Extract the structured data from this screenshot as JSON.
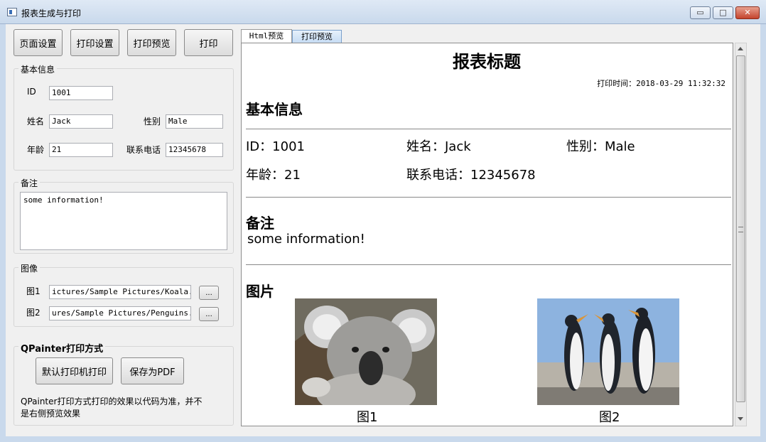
{
  "window": {
    "title": "报表生成与打印",
    "min_label": "▭",
    "max_label": "□",
    "close_label": "✕"
  },
  "toolbar": {
    "page_setup": "页面设置",
    "print_setup": "打印设置",
    "print_preview": "打印预览",
    "print": "打印"
  },
  "basic_info": {
    "title": "基本信息",
    "id_label": "ID",
    "id_value": "1001",
    "name_label": "姓名",
    "name_value": "Jack",
    "gender_label": "性别",
    "gender_value": "Male",
    "age_label": "年龄",
    "age_value": "21",
    "phone_label": "联系电话",
    "phone_value": "12345678"
  },
  "notes": {
    "title": "备注",
    "value": "some information!"
  },
  "images": {
    "title": "图像",
    "img1_label": "图1",
    "img1_path": "ictures/Sample Pictures/Koala.jpg",
    "img2_label": "图2",
    "img2_path": "ures/Sample Pictures/Penguins.jpg",
    "browse_label": "..."
  },
  "qpainter": {
    "title": "QPainter打印方式",
    "default_printer": "默认打印机打印",
    "save_pdf": "保存为PDF",
    "note_line1": "QPainter打印方式打印的效果以代码为准，并不",
    "note_line2": "是右侧预览效果"
  },
  "tabs": [
    {
      "label": "Html预览"
    },
    {
      "label": "打印预览"
    }
  ],
  "report": {
    "title": "报表标题",
    "time_label": "打印时间：",
    "time_value": "2018-03-29 11:32:32",
    "basic_heading": "基本信息",
    "id_text": "ID：1001",
    "name_text": "姓名：Jack",
    "gender_text": "性别：Male",
    "age_text": "年龄：21",
    "phone_text": "联系电话：12345678",
    "notes_heading": "备注",
    "notes_text": "some information!",
    "image_heading": "图片",
    "caption1": "图1",
    "caption2": "图2"
  },
  "colors": {
    "titlebar": "#c9d9ec",
    "window_bg": "#f0f0f0",
    "close_button": "#c4432c"
  }
}
